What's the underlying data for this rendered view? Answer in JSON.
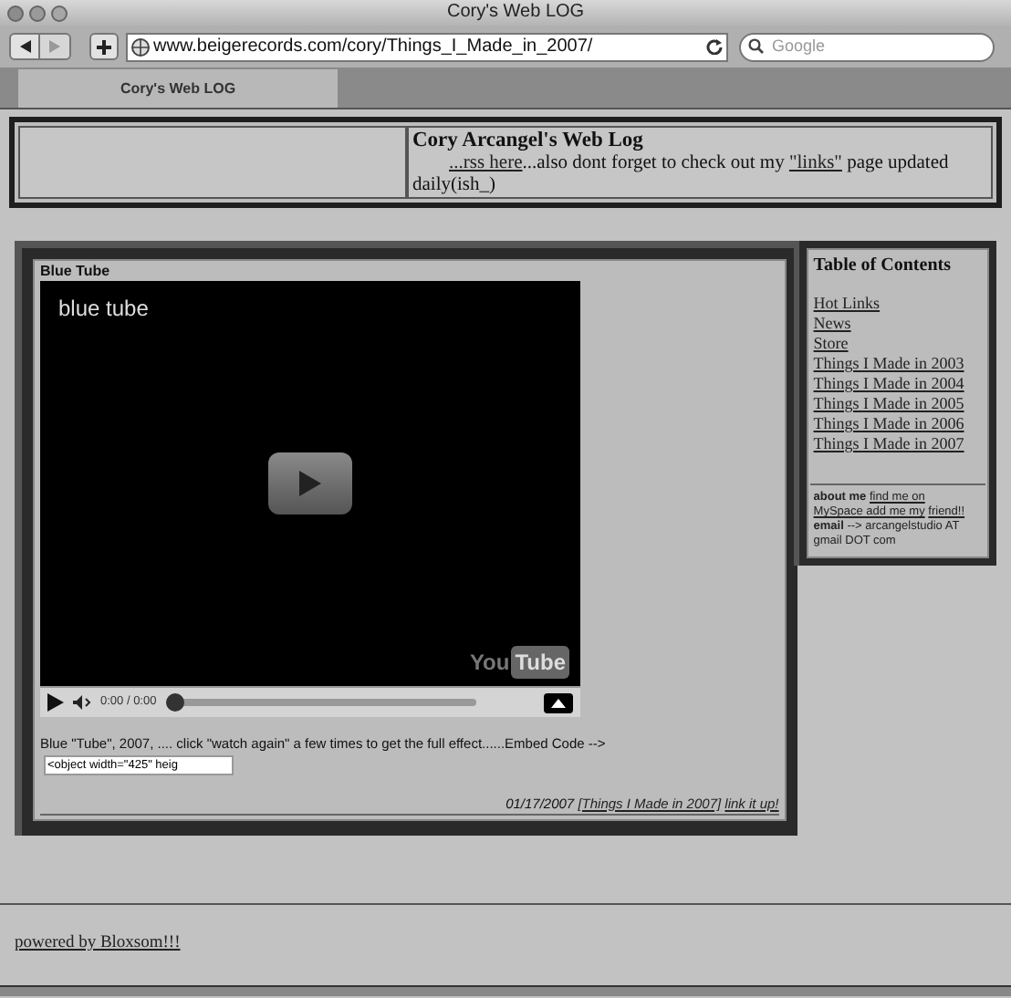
{
  "window": {
    "title": "Cory's Web LOG"
  },
  "toolbar": {
    "url": "www.beigerecords.com/cory/Things_I_Made_in_2007/",
    "search_placeholder": "Google"
  },
  "tabs": [
    {
      "label": "Cory's Web LOG",
      "selected": true
    }
  ],
  "header": {
    "title": "Cory Arcangel's Web Log",
    "intro": [
      {
        "kind": "link",
        "text": "...rss here"
      },
      {
        "kind": "text",
        "text": "...also dont forget to check out my "
      },
      {
        "kind": "link",
        "text": "\"links\""
      },
      {
        "kind": "text",
        "text": " page updated daily(ish_)"
      }
    ]
  },
  "post": {
    "title": "Blue Tube",
    "video": {
      "title": "blue tube",
      "time": "0:00 / 0:00",
      "progress": {
        "level": 0
      },
      "logo": [
        "You",
        "Tube"
      ]
    },
    "description": "Blue \"Tube\", 2007, .... click \"watch again\" a few times to get the full effect......Embed Code -->",
    "embed_value": "<object width=\"425\" heig",
    "footer": [
      {
        "kind": "text",
        "text": "01/17/2007"
      },
      {
        "kind": "link",
        "text": "[Things I Made in 2007]"
      },
      {
        "kind": "link",
        "text": "link it up!"
      }
    ]
  },
  "toc": {
    "title": "Table of Contents",
    "items": [
      "Hot Links",
      "News",
      "Store",
      "Things I Made in 2003",
      "Things I Made in 2004",
      "Things I Made in 2005",
      "Things I Made in 2006",
      "Things I Made in 2007"
    ],
    "about": [
      {
        "kind": "bold",
        "text": "about me"
      },
      {
        "kind": "link",
        "text": "find me on"
      },
      {
        "kind": "link",
        "text": "MySpace add me my"
      },
      {
        "kind": "link",
        "text": "friend!!"
      },
      {
        "kind": "bold",
        "text": "email"
      },
      {
        "kind": "text",
        "text": "--> arcangelstudio AT gmail DOT com"
      }
    ]
  },
  "footer": {
    "link": "powered by Bloxsom!!!"
  }
}
